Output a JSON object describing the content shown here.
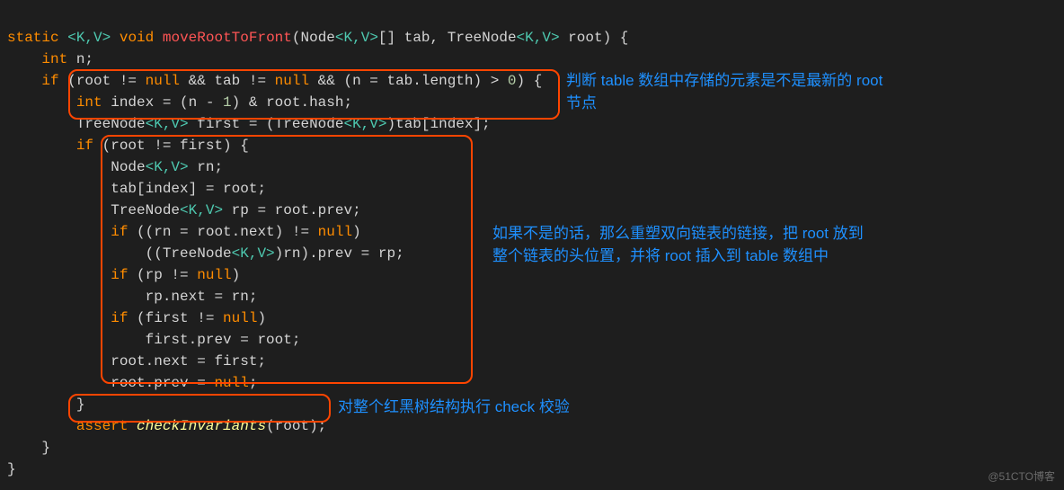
{
  "code": {
    "l1": {
      "kw1": "static",
      "gen": "<K,V>",
      "kw2": "void",
      "fn": "moveRootToFront",
      "sig": "(Node",
      "gen2": "<K,V>",
      "sig2": "[] tab, TreeNode",
      "gen3": "<K,V>",
      "sig3": " root) {"
    },
    "l2": {
      "indent": "    ",
      "kw": "int",
      "rest": " n;"
    },
    "l3": {
      "indent": "    ",
      "kw1": "if",
      "p1": " (root != ",
      "kw2": "null",
      "p2": " && tab != ",
      "kw3": "null",
      "p3": " && (n = tab.length) > ",
      "num": "0",
      "p4": ") {"
    },
    "l4": {
      "indent": "        ",
      "kw": "int",
      "p1": " index = (n - ",
      "num": "1",
      "p2": ") & root.hash;"
    },
    "l5": {
      "indent": "        ",
      "t1": "TreeNode",
      "gen": "<K,V>",
      "p1": " first = (TreeNode",
      "gen2": "<K,V>",
      "p2": ")tab[index];"
    },
    "l6": {
      "indent": "        ",
      "kw": "if",
      "p": " (root != first) {"
    },
    "l7": {
      "indent": "            ",
      "t": "Node",
      "gen": "<K,V>",
      "p": " rn;"
    },
    "l8": {
      "indent": "            ",
      "p": "tab[index] = root;"
    },
    "l9": {
      "indent": "            ",
      "t": "TreeNode",
      "gen": "<K,V>",
      "p": " rp = root.prev;"
    },
    "l10": {
      "indent": "            ",
      "kw": "if",
      "p1": " ((rn = root.next) != ",
      "kw2": "null",
      "p2": ")"
    },
    "l11": {
      "indent": "                ",
      "p1": "((TreeNode",
      "gen": "<K,V>",
      "p2": ")rn).prev = rp;"
    },
    "l12": {
      "indent": "            ",
      "kw": "if",
      "p1": " (rp != ",
      "kw2": "null",
      "p2": ")"
    },
    "l13": {
      "indent": "                ",
      "p": "rp.next = rn;"
    },
    "l14": {
      "indent": "            ",
      "kw": "if",
      "p1": " (first != ",
      "kw2": "null",
      "p2": ")"
    },
    "l15": {
      "indent": "                ",
      "p": "first.prev = root;"
    },
    "l16": {
      "indent": "            ",
      "p": "root.next = first;"
    },
    "l17": {
      "indent": "            ",
      "p1": "root.prev = ",
      "kw": "null",
      "p2": ";"
    },
    "l18": {
      "indent": "        ",
      "p": "}"
    },
    "l19": {
      "indent": "        ",
      "kw": "assert",
      "sp": " ",
      "fn": "checkInvariants",
      "p": "(root);"
    },
    "l20": {
      "indent": "    ",
      "p": "}"
    },
    "l21": {
      "p": "}"
    }
  },
  "annotations": {
    "a1": "判断 table 数组中存储的元素是不是最新的 root\n节点",
    "a2": "如果不是的话，那么重塑双向链表的链接，把 root 放到\n整个链表的头位置，并将 root 插入到 table 数组中",
    "a3": "对整个红黑树结构执行 check 校验"
  },
  "watermark": "@51CTO博客"
}
